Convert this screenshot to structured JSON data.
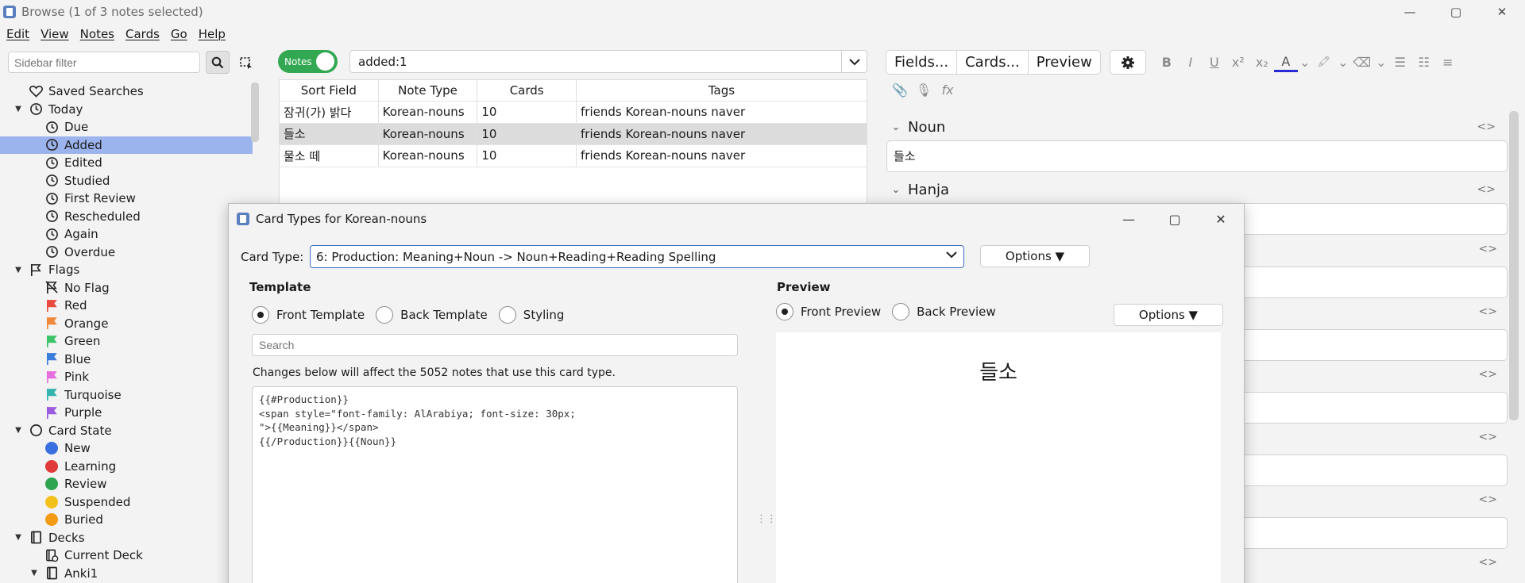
{
  "window": {
    "title": "Browse (1 of 3 notes selected)",
    "controls": [
      "—",
      "▢",
      "✕"
    ]
  },
  "menu": [
    "Edit",
    "View",
    "Notes",
    "Cards",
    "Go",
    "Help"
  ],
  "sidebar": {
    "filter_placeholder": "Sidebar filter",
    "items": [
      {
        "label": "Saved Searches",
        "icon": "heart-icon",
        "level": 1,
        "caret": ""
      },
      {
        "label": "Today",
        "icon": "clock-icon",
        "level": 1,
        "caret": "▼"
      },
      {
        "label": "Due",
        "icon": "clock-icon",
        "level": 2,
        "caret": ""
      },
      {
        "label": "Added",
        "icon": "clock-icon",
        "level": 2,
        "caret": "",
        "selected": true
      },
      {
        "label": "Edited",
        "icon": "clock-icon",
        "level": 2,
        "caret": ""
      },
      {
        "label": "Studied",
        "icon": "clock-icon",
        "level": 2,
        "caret": ""
      },
      {
        "label": "First Review",
        "icon": "clock-icon",
        "level": 2,
        "caret": ""
      },
      {
        "label": "Rescheduled",
        "icon": "clock-icon",
        "level": 2,
        "caret": ""
      },
      {
        "label": "Again",
        "icon": "clock-icon",
        "level": 2,
        "caret": ""
      },
      {
        "label": "Overdue",
        "icon": "clock-icon",
        "level": 2,
        "caret": ""
      },
      {
        "label": "Flags",
        "icon": "flag-icon",
        "level": 1,
        "caret": "▼"
      },
      {
        "label": "No Flag",
        "icon": "no-flag-icon",
        "level": 2,
        "caret": ""
      },
      {
        "label": "Red",
        "icon": "flag-icon",
        "color": "#e84a3e",
        "level": 2,
        "caret": ""
      },
      {
        "label": "Orange",
        "icon": "flag-icon",
        "color": "#f08a3a",
        "level": 2,
        "caret": ""
      },
      {
        "label": "Green",
        "icon": "flag-icon",
        "color": "#3cc46a",
        "level": 2,
        "caret": ""
      },
      {
        "label": "Blue",
        "icon": "flag-icon",
        "color": "#3a7ddd",
        "level": 2,
        "caret": ""
      },
      {
        "label": "Pink",
        "icon": "flag-icon",
        "color": "#e86ee0",
        "level": 2,
        "caret": ""
      },
      {
        "label": "Turquoise",
        "icon": "flag-icon",
        "color": "#34b5b0",
        "level": 2,
        "caret": ""
      },
      {
        "label": "Purple",
        "icon": "flag-icon",
        "color": "#9b5de0",
        "level": 2,
        "caret": ""
      },
      {
        "label": "Card State",
        "icon": "circle-icon",
        "level": 1,
        "caret": "▼"
      },
      {
        "label": "New",
        "icon": "dot-icon",
        "color": "#3a6fe0",
        "level": 2,
        "caret": ""
      },
      {
        "label": "Learning",
        "icon": "dot-icon",
        "color": "#e03a3a",
        "level": 2,
        "caret": ""
      },
      {
        "label": "Review",
        "icon": "dot-icon",
        "color": "#2ea44f",
        "level": 2,
        "caret": ""
      },
      {
        "label": "Suspended",
        "icon": "dot-icon",
        "color": "#f2c21b",
        "level": 2,
        "caret": ""
      },
      {
        "label": "Buried",
        "icon": "dot-icon",
        "color": "#f39c12",
        "level": 2,
        "caret": ""
      },
      {
        "label": "Decks",
        "icon": "deck-icon",
        "level": 1,
        "caret": "▼"
      },
      {
        "label": "Current Deck",
        "icon": "current-deck-icon",
        "level": 2,
        "caret": ""
      },
      {
        "label": "Anki1",
        "icon": "deck-icon",
        "level": 2,
        "caret": "▼"
      }
    ]
  },
  "toolbar": {
    "toggle_label": "Notes",
    "search_value": "added:1"
  },
  "table": {
    "columns": [
      "Sort Field",
      "Note Type",
      "Cards",
      "Tags"
    ],
    "rows": [
      [
        "잠귀(가) 밝다",
        "Korean-nouns",
        "10",
        "friends Korean-nouns naver"
      ],
      [
        "들소",
        "Korean-nouns",
        "10",
        "friends Korean-nouns naver"
      ],
      [
        "물소 떼",
        "Korean-nouns",
        "10",
        "friends Korean-nouns naver"
      ]
    ],
    "selected_row": 1
  },
  "editor": {
    "buttons": [
      "Fields...",
      "Cards...",
      "Preview"
    ],
    "format_buttons": [
      "B",
      "I",
      "U",
      "x²",
      "x₂",
      "A",
      "⌄",
      "🖍",
      "⌄",
      "⌫",
      "⌄",
      "☰",
      "☷",
      "≡"
    ],
    "attach_buttons": [
      "📎",
      "🎙",
      "fx"
    ],
    "fields": [
      {
        "name": "Noun",
        "value": "들소"
      },
      {
        "name": "Hanja",
        "value": ""
      }
    ],
    "code_toggle": "<>"
  },
  "dialog": {
    "title": "Card Types for Korean-nouns",
    "card_type_label": "Card Type:",
    "card_type_value": "6: Production: Meaning+Noun -> Noun+Reading+Reading Spelling",
    "options_label": "Options ▼",
    "template_title": "Template",
    "template_radios": [
      "Front Template",
      "Back Template",
      "Styling"
    ],
    "template_search_placeholder": "Search",
    "changes_notice": "Changes below will affect the 5052 notes that use this card type.",
    "template_code": "{{#Production}}\n<span style=\"font-family: AlArabiya; font-size: 30px;\n\">{{Meaning}}</span>\n{{/Production}}{{Noun}}",
    "preview_title": "Preview",
    "preview_radios": [
      "Front Preview",
      "Back Preview"
    ],
    "preview_options_label": "Options ▼",
    "preview_text": "들소"
  }
}
